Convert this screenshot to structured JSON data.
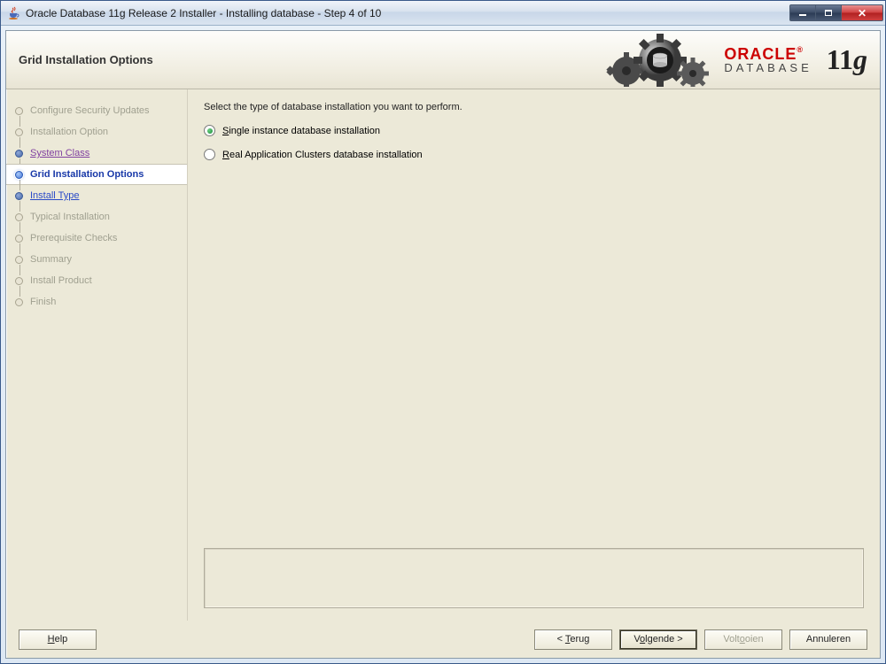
{
  "window": {
    "title": "Oracle Database 11g Release 2 Installer - Installing database - Step 4 of 10"
  },
  "header": {
    "page_title": "Grid Installation Options",
    "brand_top": "ORACLE",
    "brand_bottom": "DATABASE",
    "brand_version": "11",
    "brand_suffix": "g"
  },
  "sidebar": {
    "steps": [
      {
        "label": "Configure Security Updates",
        "state": "disabled"
      },
      {
        "label": "Installation Option",
        "state": "disabled"
      },
      {
        "label": "System Class",
        "state": "visited"
      },
      {
        "label": "Grid Installation Options",
        "state": "current"
      },
      {
        "label": "Install Type",
        "state": "link"
      },
      {
        "label": "Typical Installation",
        "state": "disabled"
      },
      {
        "label": "Prerequisite Checks",
        "state": "disabled"
      },
      {
        "label": "Summary",
        "state": "disabled"
      },
      {
        "label": "Install Product",
        "state": "disabled"
      },
      {
        "label": "Finish",
        "state": "disabled"
      }
    ]
  },
  "main": {
    "prompt": "Select the type of database installation you want to perform.",
    "options": [
      {
        "mnemonic": "S",
        "rest": "ingle instance database installation",
        "checked": true
      },
      {
        "mnemonic": "R",
        "rest": "eal Application Clusters database installation",
        "checked": false
      }
    ]
  },
  "buttons": {
    "help": {
      "mnemonic": "H",
      "rest": "elp"
    },
    "back": {
      "prefix": "< ",
      "mnemonic": "T",
      "rest": "erug"
    },
    "next": {
      "prefix": "V",
      "mnemonic": "o",
      "rest": "lgende >"
    },
    "finish": {
      "prefix": "Volt",
      "mnemonic": "o",
      "rest": "oien"
    },
    "cancel": {
      "label": "Annuleren"
    }
  }
}
